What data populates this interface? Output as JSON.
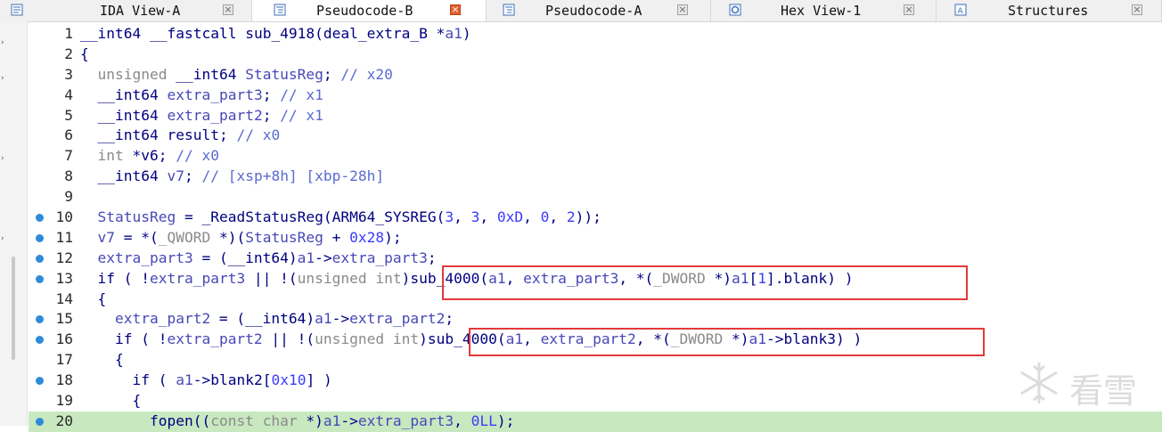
{
  "tabs": [
    {
      "label": "IDA View-A",
      "icon": "disassembly-icon",
      "active": false
    },
    {
      "label": "Pseudocode-B",
      "icon": "pseudocode-icon",
      "active": true
    },
    {
      "label": "Pseudocode-A",
      "icon": "pseudocode-icon",
      "active": false
    },
    {
      "label": "Hex View-1",
      "icon": "hex-view-icon",
      "active": false
    },
    {
      "label": "Structures",
      "icon": "structures-icon",
      "active": false
    }
  ],
  "code": {
    "highlight_color": "#c8e8c0",
    "breakpoint_color": "#2e8bd8",
    "annotation_color": "#e23a3a",
    "lines": [
      {
        "n": "1",
        "bp": false,
        "text": "__int64 __fastcall sub_4918(deal_extra_B *a1)"
      },
      {
        "n": "2",
        "bp": false,
        "text": "{"
      },
      {
        "n": "3",
        "bp": false,
        "text": "  unsigned __int64 StatusReg; // x20"
      },
      {
        "n": "4",
        "bp": false,
        "text": "  __int64 extra_part3; // x1"
      },
      {
        "n": "5",
        "bp": false,
        "text": "  __int64 extra_part2; // x1"
      },
      {
        "n": "6",
        "bp": false,
        "text": "  __int64 result; // x0"
      },
      {
        "n": "7",
        "bp": false,
        "text": "  int *v6; // x0"
      },
      {
        "n": "8",
        "bp": false,
        "text": "  __int64 v7; // [xsp+8h] [xbp-28h]"
      },
      {
        "n": "9",
        "bp": false,
        "text": ""
      },
      {
        "n": "10",
        "bp": true,
        "text": "  StatusReg = _ReadStatusReg(ARM64_SYSREG(3, 3, 0xD, 0, 2));"
      },
      {
        "n": "11",
        "bp": true,
        "text": "  v7 = *(_QWORD *)(StatusReg + 0x28);"
      },
      {
        "n": "12",
        "bp": true,
        "text": "  extra_part3 = (__int64)a1->extra_part3;"
      },
      {
        "n": "13",
        "bp": true,
        "text": "  if ( !extra_part3 || !(unsigned int)sub_4000(a1, extra_part3, *(_DWORD *)a1[1].blank) )"
      },
      {
        "n": "14",
        "bp": false,
        "text": "  {"
      },
      {
        "n": "15",
        "bp": true,
        "text": "    extra_part2 = (__int64)a1->extra_part2;"
      },
      {
        "n": "16",
        "bp": true,
        "text": "    if ( !extra_part2 || !(unsigned int)sub_4000(a1, extra_part2, *(_DWORD *)a1->blank3) )"
      },
      {
        "n": "17",
        "bp": false,
        "text": "    {"
      },
      {
        "n": "18",
        "bp": true,
        "text": "      if ( a1->blank2[0x10] )"
      },
      {
        "n": "19",
        "bp": false,
        "text": "      {"
      },
      {
        "n": "20",
        "bp": true,
        "text": "        fopen((const char *)a1->extra_part3, 0LL);"
      }
    ]
  },
  "watermark": {
    "icon": "snowflake-logo-icon",
    "text": "看雪"
  }
}
